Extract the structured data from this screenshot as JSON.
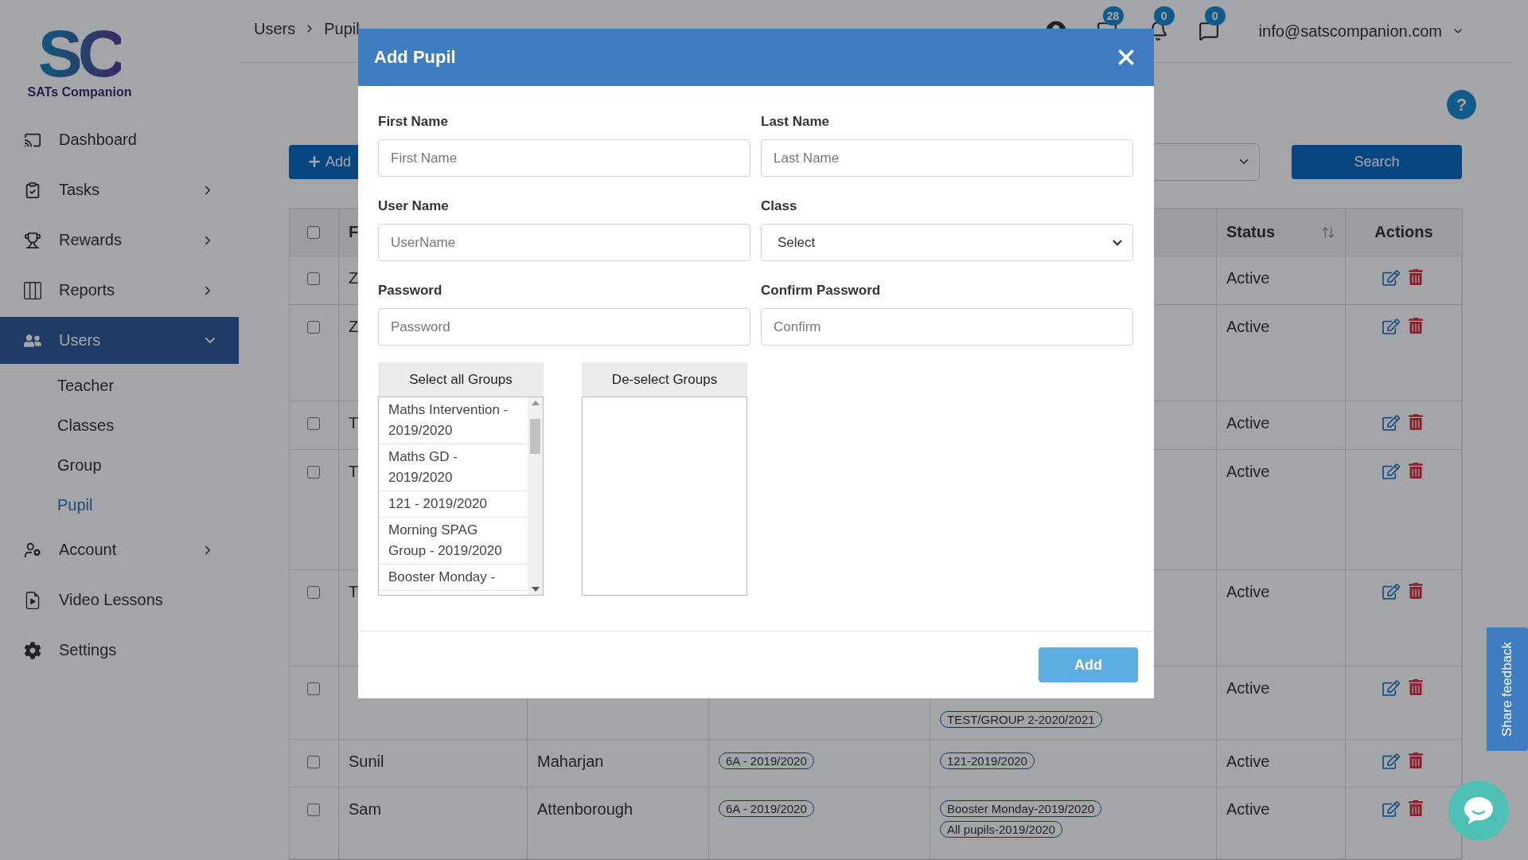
{
  "sidebar": {
    "logo": "SC",
    "brand": "SATs Companion",
    "items": [
      {
        "label": "Dashboard",
        "selected": false
      },
      {
        "label": "Tasks",
        "selected": false,
        "expanded": false
      },
      {
        "label": "Rewards",
        "selected": false,
        "expanded": false
      },
      {
        "label": "Reports",
        "selected": false,
        "expanded": false
      },
      {
        "label": "Users",
        "selected": true,
        "expanded": true,
        "children": [
          {
            "label": "Teacher",
            "selected": false
          },
          {
            "label": "Classes",
            "selected": false
          },
          {
            "label": "Group",
            "selected": false
          },
          {
            "label": "Pupil",
            "selected": true
          }
        ]
      },
      {
        "label": "Account",
        "selected": false,
        "expanded": false
      },
      {
        "label": "Video Lessons",
        "selected": false
      },
      {
        "label": "Settings",
        "selected": false
      }
    ]
  },
  "breadcrumb": [
    "Users",
    "Pupil"
  ],
  "header": {
    "badges": [
      "28",
      "0",
      "0"
    ],
    "account": "info@satscompanion.com"
  },
  "help": "?",
  "toolbar": {
    "add_button": "Add",
    "search_button": "Search"
  },
  "table": {
    "columns": {
      "first": "F",
      "status": "Status",
      "actions": "Actions"
    },
    "status_sortable": true,
    "header_checked": false,
    "rows": [
      {
        "checked": false,
        "first_name": "Z",
        "status": "Active"
      },
      {
        "checked": false,
        "first_name": "Z",
        "status": "Active"
      },
      {
        "checked": false,
        "first_name": "T",
        "status": "Active"
      },
      {
        "checked": false,
        "first_name": "T",
        "status": "Active"
      },
      {
        "checked": false,
        "first_name": "T",
        "status": "Active"
      },
      {
        "checked": false,
        "groups": [
          "TEST/GROUP 2-2020/2021"
        ],
        "status": "Active"
      },
      {
        "checked": false,
        "first_name": "Sunil",
        "last_name": "Maharjan",
        "class": "6A - 2019/2020",
        "groups": [
          "121-2019/2020"
        ],
        "status": "Active"
      },
      {
        "checked": false,
        "first_name": "Sam",
        "last_name": "Attenborough",
        "class": "6A - 2019/2020",
        "groups": [
          "Booster Monday-2019/2020",
          "All pupils-2019/2020"
        ],
        "status": "Active"
      }
    ]
  },
  "modal": {
    "title": "Add Pupil",
    "fields": [
      {
        "kind": "input",
        "label": "First Name",
        "placeholder": "First Name"
      },
      {
        "kind": "input",
        "label": "Last Name",
        "placeholder": "Last Name"
      },
      {
        "kind": "input",
        "label": "User Name",
        "placeholder": "UserName"
      },
      {
        "kind": "select",
        "label": "Class",
        "value": "Select"
      },
      {
        "kind": "input",
        "label": "Password",
        "placeholder": "Password"
      },
      {
        "kind": "input",
        "label": "Confirm Password",
        "placeholder": "Confirm"
      }
    ],
    "select_all": "Select all Groups",
    "deselect": "De-select Groups",
    "available_groups": [
      "Maths Intervention - 2019/2020",
      "Maths GD - 2019/2020",
      "121 - 2019/2020",
      "Morning SPAG Group - 2019/2020",
      "Booster Monday -"
    ],
    "submit": "Add"
  },
  "feedback": "Share feedback"
}
